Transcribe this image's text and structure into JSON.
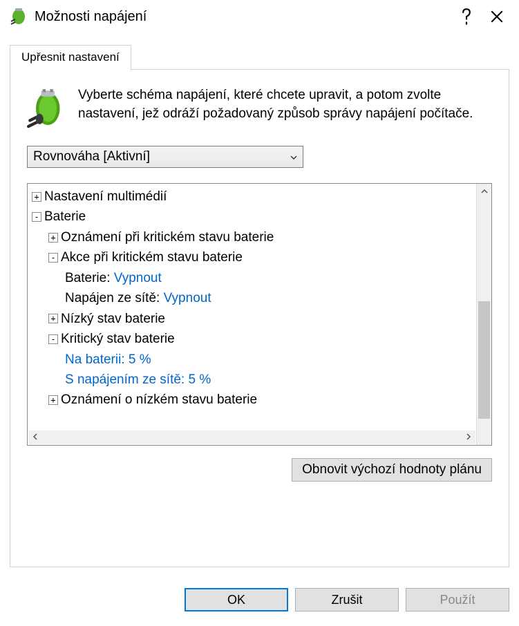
{
  "window": {
    "title": "Možnosti napájení"
  },
  "tab": {
    "advanced": "Upřesnit nastavení"
  },
  "description": "Vyberte schéma napájení, které chcete upravit, a potom zvolte nastavení, jež odráží požadovaný způsob správy napájení počítače.",
  "plan": {
    "selected": "Rovnováha [Aktivní]"
  },
  "tree": {
    "multimedia": {
      "label": "Nastavení multimédií",
      "expanded": false
    },
    "battery": {
      "label": "Baterie",
      "expanded": true,
      "critical_notification": {
        "label": "Oznámení při kritickém stavu baterie",
        "expanded": false
      },
      "critical_action": {
        "label": "Akce při kritickém stavu baterie",
        "expanded": true,
        "on_battery_label": "Baterie:",
        "on_battery_value": "Vypnout",
        "plugged_label": "Napájen ze sítě:",
        "plugged_value": "Vypnout"
      },
      "low_level": {
        "label": "Nízký stav baterie",
        "expanded": false
      },
      "critical_level": {
        "label": "Kritický stav baterie",
        "expanded": true,
        "on_battery": "Na baterii: 5 %",
        "plugged": "S napájením ze sítě: 5 %"
      },
      "low_notification": {
        "label": "Oznámení o nízkém stavu baterie",
        "expanded": false
      }
    }
  },
  "buttons": {
    "restore": "Obnovit výchozí hodnoty plánu",
    "ok": "OK",
    "cancel": "Zrušit",
    "apply": "Použít"
  }
}
